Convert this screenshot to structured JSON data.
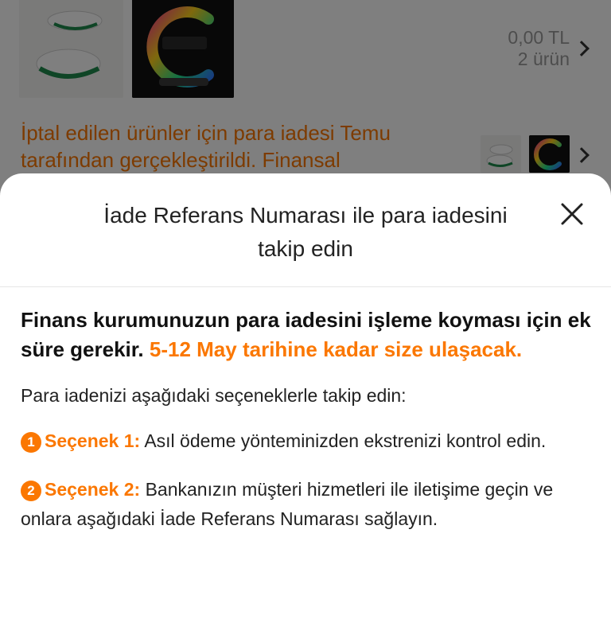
{
  "background": {
    "order_total": "0,00 TL",
    "order_item_count": "2 ürün",
    "refund_notice": "İptal edilen ürünler için para iadesi Temu tarafından gerçekleştirildi. Finansal"
  },
  "sheet": {
    "title": "İade Referans Numarası ile para iadesini takip edin",
    "lead_text": "Finans kurumunuzun para iadesini işleme koyması için ek süre gerekir.",
    "lead_highlight": "5-12 May tarihine kadar size ulaşacak.",
    "subtitle": "Para iadenizi aşağıdaki seçeneklerle takip edin:",
    "options": [
      {
        "number": "1",
        "label": "Seçenek 1:",
        "text": "Asıl ödeme yönteminizden ekstrenizi kontrol edin."
      },
      {
        "number": "2",
        "label": "Seçenek 2:",
        "text": "Bankanızın müşteri hizmetleri ile iletişime geçin ve onlara aşağıdaki İade Referans Numarası sağlayın."
      }
    ]
  },
  "icons": {
    "close": "close-icon",
    "chevron": "chevron-right-icon"
  },
  "colors": {
    "accent": "#fb7701",
    "overlay": "rgba(0,0,0,0.5)"
  }
}
